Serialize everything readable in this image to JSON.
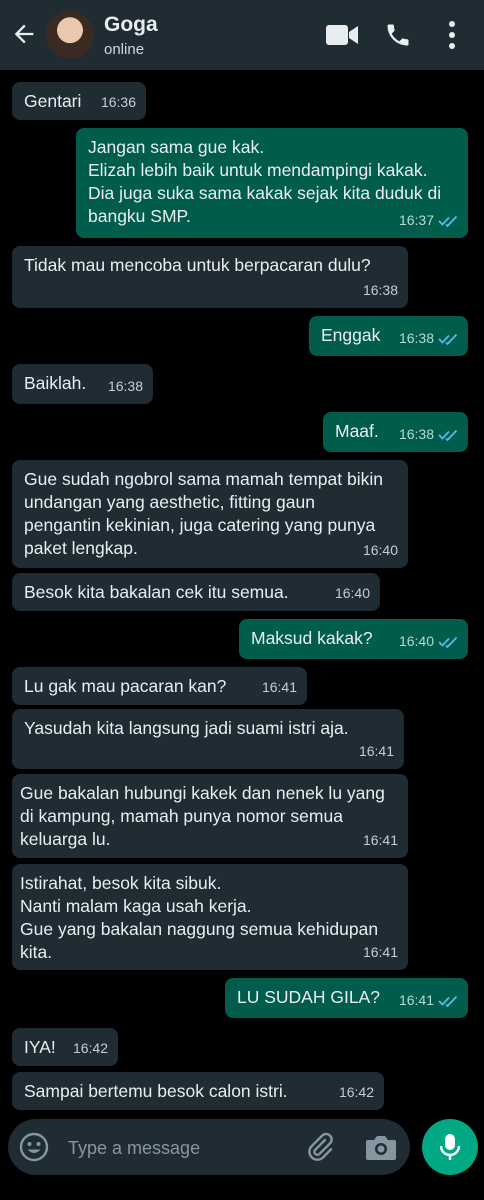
{
  "header": {
    "contact_name": "Goga",
    "status": "online"
  },
  "messages": [
    {
      "text": "Gentari",
      "time": "16:36",
      "dir": "in"
    },
    {
      "text": "Jangan sama gue kak.\nElizah lebih baik untuk mendampingi kakak. Dia juga suka sama kakak sejak kita duduk di bangku SMP.",
      "time": "16:37",
      "dir": "out"
    },
    {
      "text": "Tidak mau mencoba untuk berpacaran dulu?",
      "time": "16:38",
      "dir": "in"
    },
    {
      "text": "Enggak",
      "time": "16:38",
      "dir": "out"
    },
    {
      "text": "Baiklah.",
      "time": "16:38",
      "dir": "in"
    },
    {
      "text": "Maaf.",
      "time": "16:38",
      "dir": "out"
    },
    {
      "text": "Gue sudah ngobrol sama mamah tempat bikin undangan yang aesthetic, fitting gaun pengantin kekinian, juga catering yang punya paket lengkap.",
      "time": "16:40",
      "dir": "in"
    },
    {
      "text": "Besok kita bakalan cek itu semua.",
      "time": "16:40",
      "dir": "in"
    },
    {
      "text": "Maksud kakak?",
      "time": "16:40",
      "dir": "out"
    },
    {
      "text": "Lu gak mau pacaran kan?",
      "time": "16:41",
      "dir": "in"
    },
    {
      "text": "Yasudah kita langsung jadi suami istri aja.",
      "time": "16:41",
      "dir": "in"
    },
    {
      "text": "Gue bakalan hubungi kakek dan nenek lu yang di kampung, mamah punya nomor semua keluarga lu.",
      "time": "16:41",
      "dir": "in"
    },
    {
      "text": "Istirahat, besok kita sibuk.\nNanti malam kaga usah kerja.\nGue yang bakalan naggung semua kehidupan kita.",
      "time": "16:41",
      "dir": "in"
    },
    {
      "text": "LU SUDAH GILA?",
      "time": "16:41",
      "dir": "out"
    },
    {
      "text": "IYA!",
      "time": "16:42",
      "dir": "in"
    },
    {
      "text": "Sampai bertemu besok calon istri.",
      "time": "16:42",
      "dir": "in"
    }
  ],
  "composer": {
    "placeholder": "Type a message"
  },
  "colors": {
    "header_bg": "#1f2c34",
    "incoming_bubble": "#1f2c34",
    "outgoing_bubble": "#005c4b",
    "read_ticks": "#53bdeb",
    "mic_button": "#00a884"
  }
}
